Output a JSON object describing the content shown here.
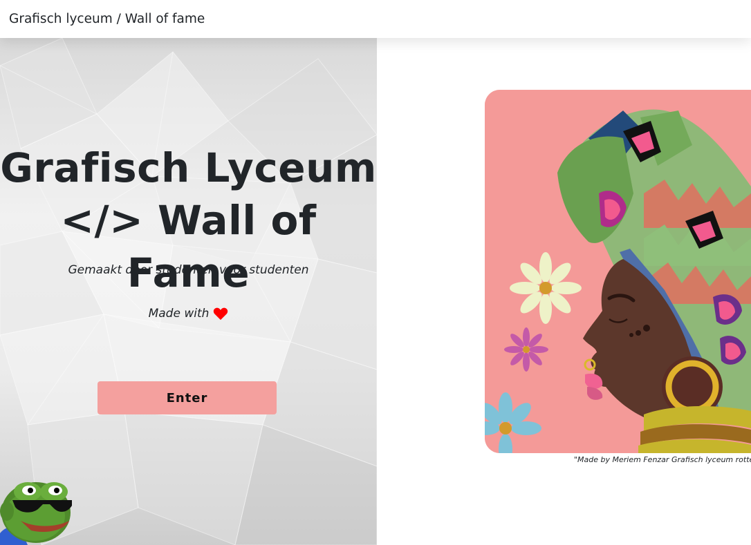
{
  "navbar": {
    "brand": "Grafisch lyceum / Wall of fame"
  },
  "hero": {
    "title_line1": "Grafisch Lyceum",
    "title_line2": "</> Wall of Fame",
    "subtitle": "Gemaakt door studenten voor studenten",
    "made_with": "Made with",
    "heart_icon": "heart-icon",
    "heart_color": "#ff0000",
    "enter_label": "Enter",
    "button_color": "#f4a09e"
  },
  "artwork": {
    "caption": "\"Made by Meriem Fenzar Grafisch lyceum rotterdam\"",
    "background": "#f49a98"
  },
  "mascot": {
    "icon": "pepe-frog-sunglasses"
  }
}
